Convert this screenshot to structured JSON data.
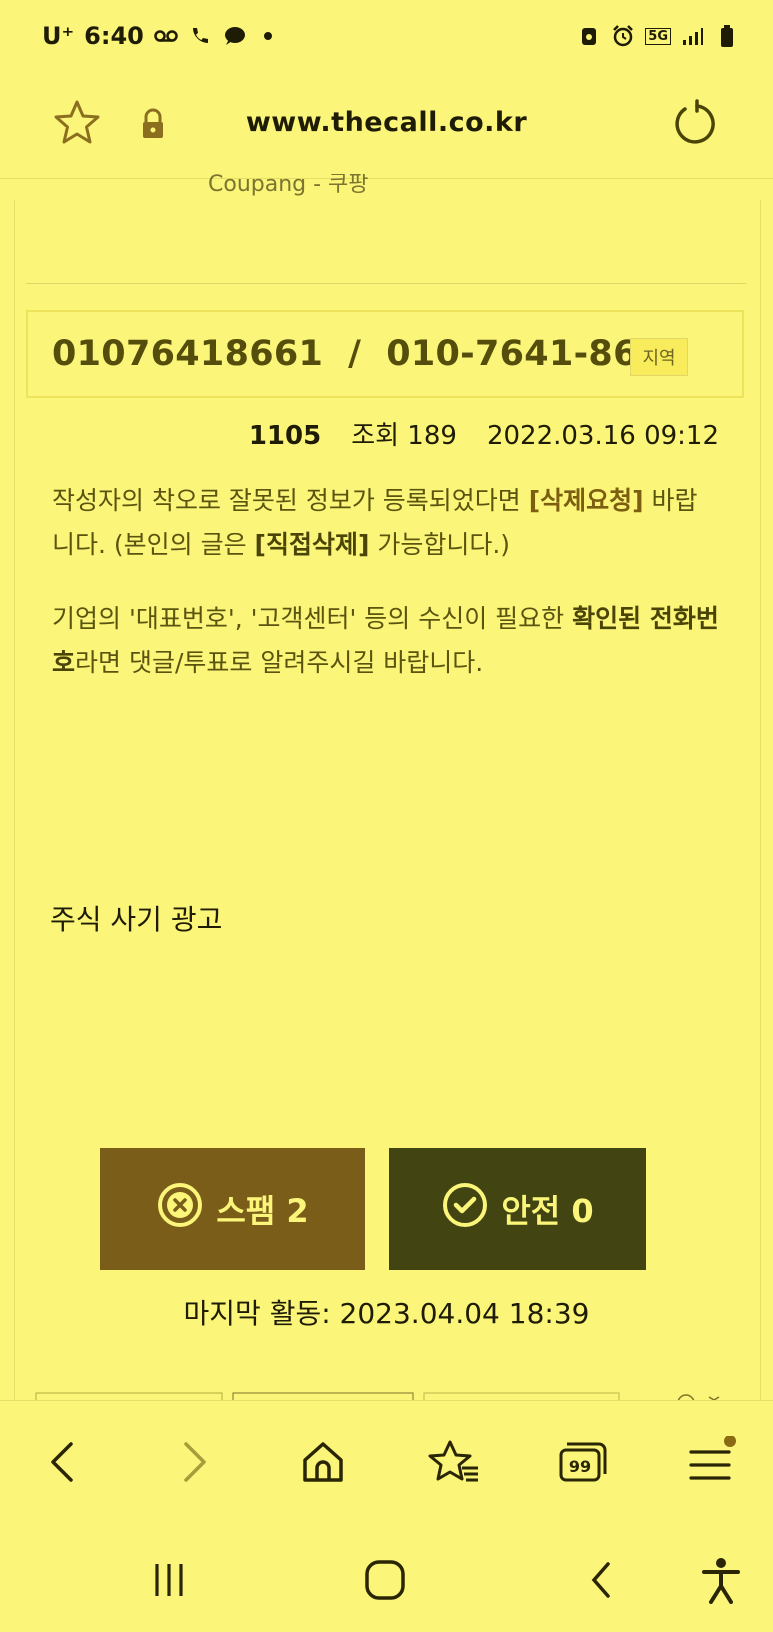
{
  "status_bar": {
    "carrier": "U⁺",
    "time": "6:40",
    "network": "5G"
  },
  "browser": {
    "url": "www.thecall.co.kr"
  },
  "page": {
    "cut_text": "Coupang - 쿠팡",
    "phone_display": "01076418661  /  010-7641-8661",
    "region_tag": "지역",
    "post_number": "1105",
    "views": "조회 189",
    "date": "2022.03.16 09:12",
    "notice1_a": "작성자의 착오로 잘못된 정보가 등록되었다면 ",
    "notice1_hl1": "[삭제요청]",
    "notice1_b": " 바랍니다. (본인의 글은 ",
    "notice1_hl2": "[직접삭제]",
    "notice1_c": " 가능합니다.)",
    "notice2_a": "기업의 '대표번호', '고객센터' 등의 수신이 필요한 ",
    "notice2_hl": "확인된 전화번호",
    "notice2_b": "라면 댓글/투표로 알려주시길 바랍니다.",
    "content": "주식 사기 광고",
    "spam_label": "스팸 2",
    "safe_label": "안전 0",
    "last_activity": "마지막 활동: 2023.04.04 18:39"
  },
  "colors": {
    "background": "#fbf57a",
    "spam_button": "#7a5d19",
    "safe_button": "#424512",
    "accent_text": "#544d0b"
  },
  "icons": {
    "bookmark": "star-icon",
    "secure": "lock-icon",
    "reload": "refresh-icon",
    "spam": "x-circle-icon",
    "safe": "check-circle-icon"
  }
}
